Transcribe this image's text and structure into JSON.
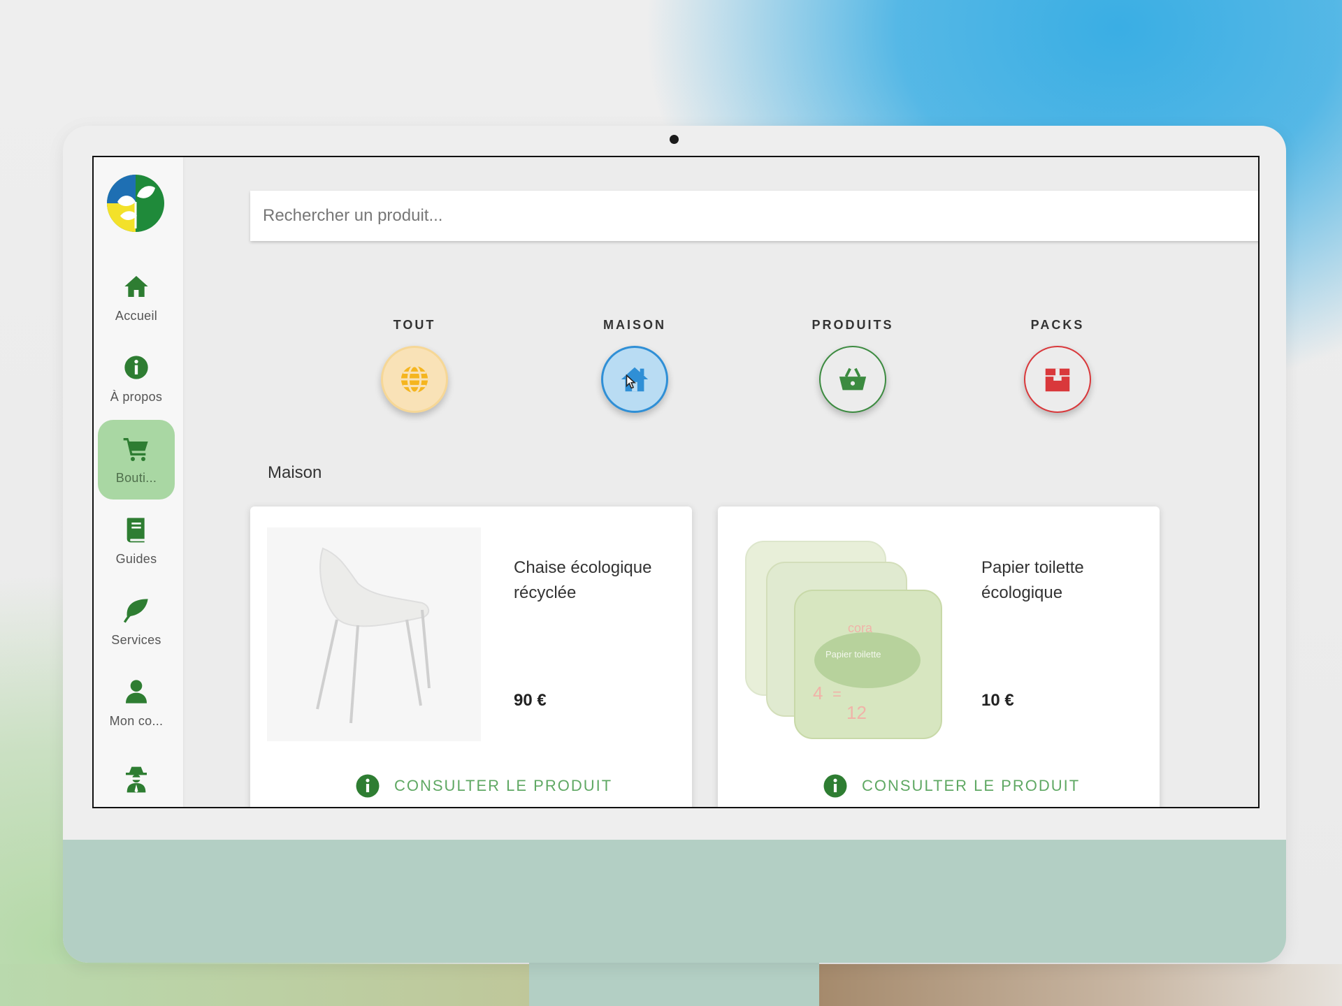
{
  "search": {
    "placeholder": "Rechercher un produit..."
  },
  "sidebar": {
    "items": [
      {
        "label": "Accueil",
        "icon": "home-icon",
        "active": false
      },
      {
        "label": "À propos",
        "icon": "info-icon",
        "active": false
      },
      {
        "label": "Bouti...",
        "icon": "cart-icon",
        "active": true
      },
      {
        "label": "Guides",
        "icon": "book-icon",
        "active": false
      },
      {
        "label": "Services",
        "icon": "leaf-icon",
        "active": false
      },
      {
        "label": "Mon co...",
        "icon": "user-icon",
        "active": false
      },
      {
        "label": "",
        "icon": "user-secret-icon",
        "active": false
      }
    ]
  },
  "categories": [
    {
      "label": "TOUT",
      "icon": "globe-icon",
      "color": "#f5c542",
      "fill": "#f9e2b7"
    },
    {
      "label": "MAISON",
      "icon": "house-icon",
      "color": "#2f8fd6",
      "fill": "#b9dcf3"
    },
    {
      "label": "PRODUITS",
      "icon": "basket-icon",
      "color": "#3c8b40",
      "fill": "#ececec"
    },
    {
      "label": "PACKS",
      "icon": "box-icon",
      "color": "#d9383b",
      "fill": "#ececec"
    }
  ],
  "section": {
    "title": "Maison"
  },
  "products": [
    {
      "name": "Chaise écologique récyclée",
      "price": "90 €",
      "cta": "CONSULTER LE PRODUIT",
      "image": "chair-image"
    },
    {
      "name": "Papier toilette écologique",
      "price": "10 €",
      "cta": "CONSULTER LE PRODUIT",
      "image": "toilet-paper-image"
    }
  ],
  "toilet_paper_pack": {
    "brand": "cora",
    "line": "Papier toilette",
    "deal_left": "4",
    "deal_sign": "=",
    "deal_right": "12"
  },
  "colors": {
    "accent_green": "#2e7d32",
    "cta_green": "#5fa863",
    "active_nav": "#a9d7a3"
  }
}
